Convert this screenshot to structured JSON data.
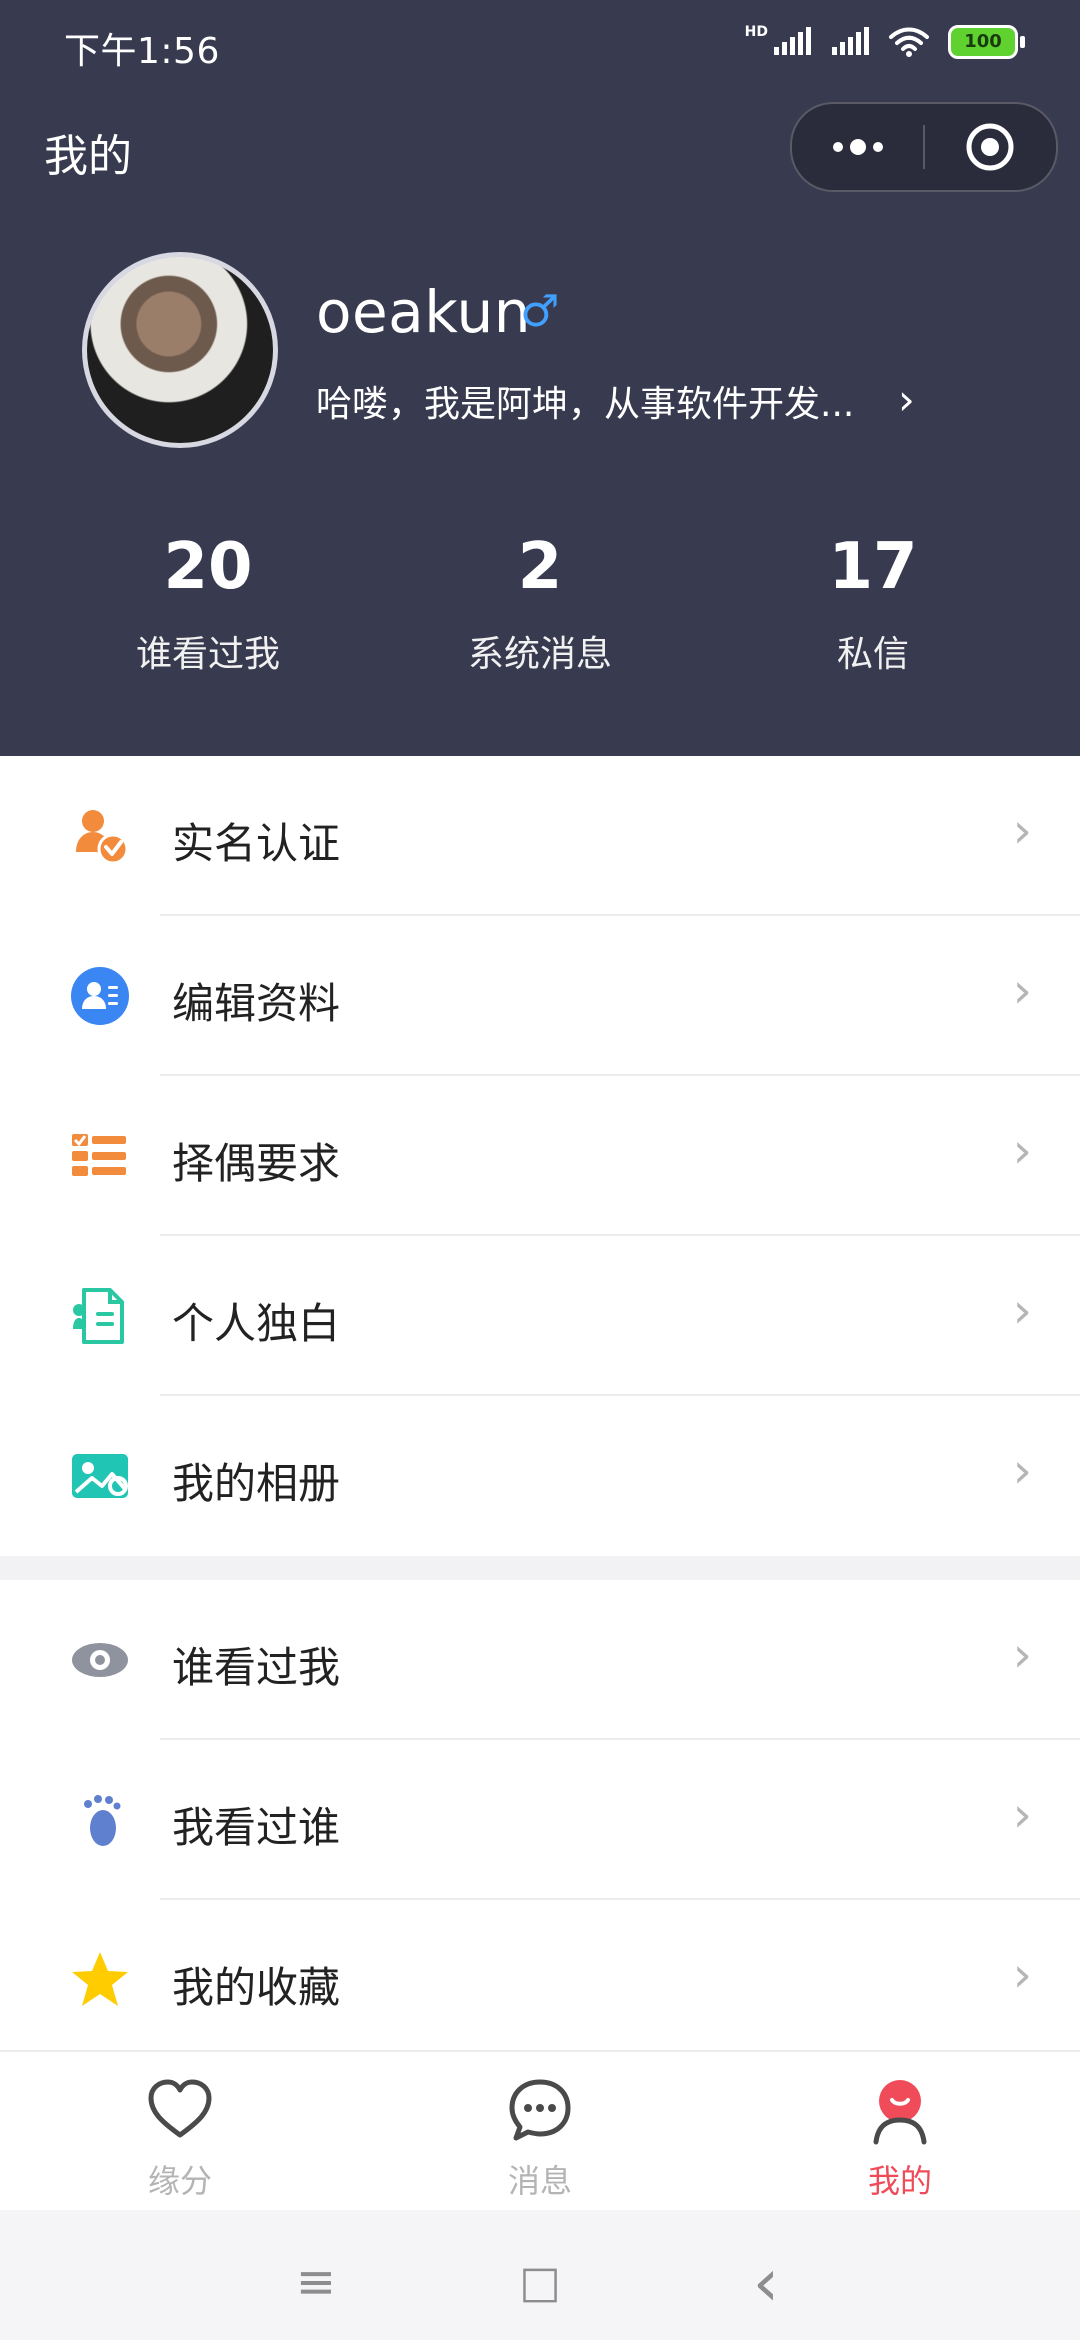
{
  "status": {
    "time": "下午1:56",
    "battery": "100",
    "signal_label": "HD"
  },
  "header": {
    "title": "我的",
    "menu_icon": "more-dots-icon",
    "close_icon": "record-icon"
  },
  "profile": {
    "username": "oeakun",
    "gender": "♂",
    "bio": "哈喽，我是阿坤，从事软件开发..."
  },
  "stats": [
    {
      "value": "20",
      "label": "谁看过我"
    },
    {
      "value": "2",
      "label": "系统消息"
    },
    {
      "value": "17",
      "label": "私信"
    }
  ],
  "menu_groups": [
    [
      {
        "label": "实名认证",
        "icon": "verification-icon",
        "color": "#f28b3c"
      },
      {
        "label": "编辑资料",
        "icon": "profile-edit-icon",
        "color": "#3a86f3"
      },
      {
        "label": "择偶要求",
        "icon": "checklist-icon",
        "color": "#f28b3c"
      },
      {
        "label": "个人独白",
        "icon": "document-icon",
        "color": "#29c7a2"
      },
      {
        "label": "我的相册",
        "icon": "photo-album-icon",
        "color": "#21c5b4"
      }
    ],
    [
      {
        "label": "谁看过我",
        "icon": "eye-icon",
        "color": "#8e939e"
      },
      {
        "label": "我看过谁",
        "icon": "footprint-icon",
        "color": "#5f7fcf"
      },
      {
        "label": "我的收藏",
        "icon": "star-icon",
        "color": "#ffcc00"
      }
    ]
  ],
  "tabs": [
    {
      "label": "缘分",
      "icon": "heart-icon"
    },
    {
      "label": "消息",
      "icon": "message-icon"
    },
    {
      "label": "我的",
      "icon": "mine-icon"
    }
  ],
  "system_nav": {
    "menu": "≡",
    "home": "□",
    "back": "‹"
  },
  "colors": {
    "header_bg": "#383a4f",
    "active_tab": "#ef4b59"
  }
}
